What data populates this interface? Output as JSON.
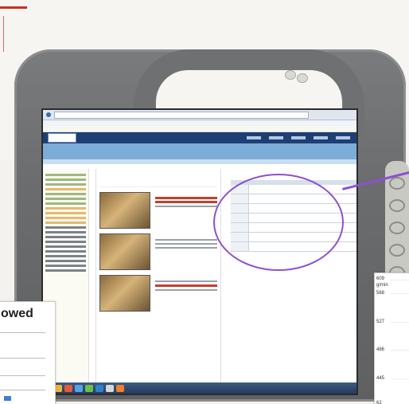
{
  "inset_left": {
    "heading_fragment": "owed"
  },
  "inset_right": {
    "unit": "g/min",
    "ticks": [
      "609",
      "568",
      "527",
      "486",
      "445",
      "62"
    ]
  }
}
